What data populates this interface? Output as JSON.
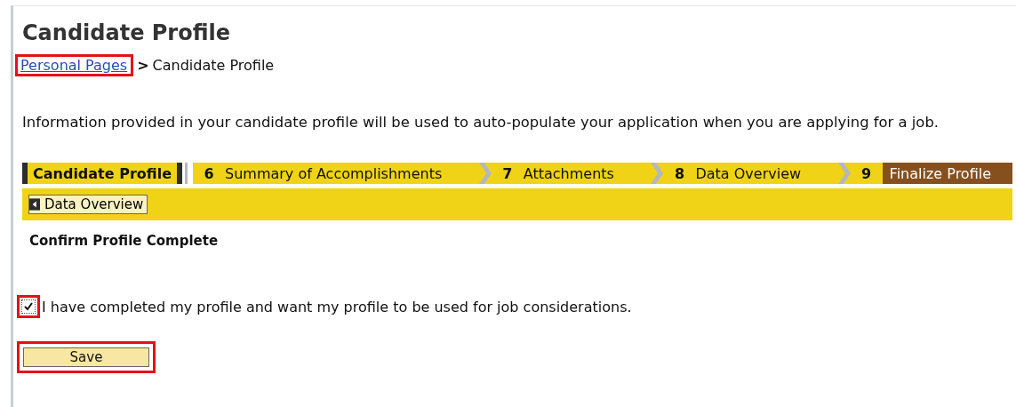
{
  "page": {
    "title": "Candidate Profile"
  },
  "breadcrumb": {
    "link": {
      "label": "Personal Pages",
      "highlighted": true
    },
    "separator": ">",
    "current": "Candidate Profile"
  },
  "intro": "Information provided in your candidate profile will be used to auto-populate your application when you are applying for a job.",
  "steps": [
    {
      "kind": "title",
      "label": "Candidate Profile"
    },
    {
      "kind": "step",
      "number": "6",
      "label": "Summary of Accomplishments",
      "selected": false
    },
    {
      "kind": "step",
      "number": "7",
      "label": "Attachments",
      "selected": false
    },
    {
      "kind": "step",
      "number": "8",
      "label": "Data Overview",
      "selected": false
    },
    {
      "kind": "step",
      "number": "9",
      "label": "Finalize Profile",
      "selected": true
    }
  ],
  "back_button": {
    "label": "Data Overview"
  },
  "section_title": "Confirm Profile Complete",
  "confirm": {
    "label": "I have completed my profile and want my profile to be used for job considerations.",
    "checked": true,
    "highlighted": true
  },
  "save_button": {
    "label": "Save",
    "highlighted": true
  }
}
